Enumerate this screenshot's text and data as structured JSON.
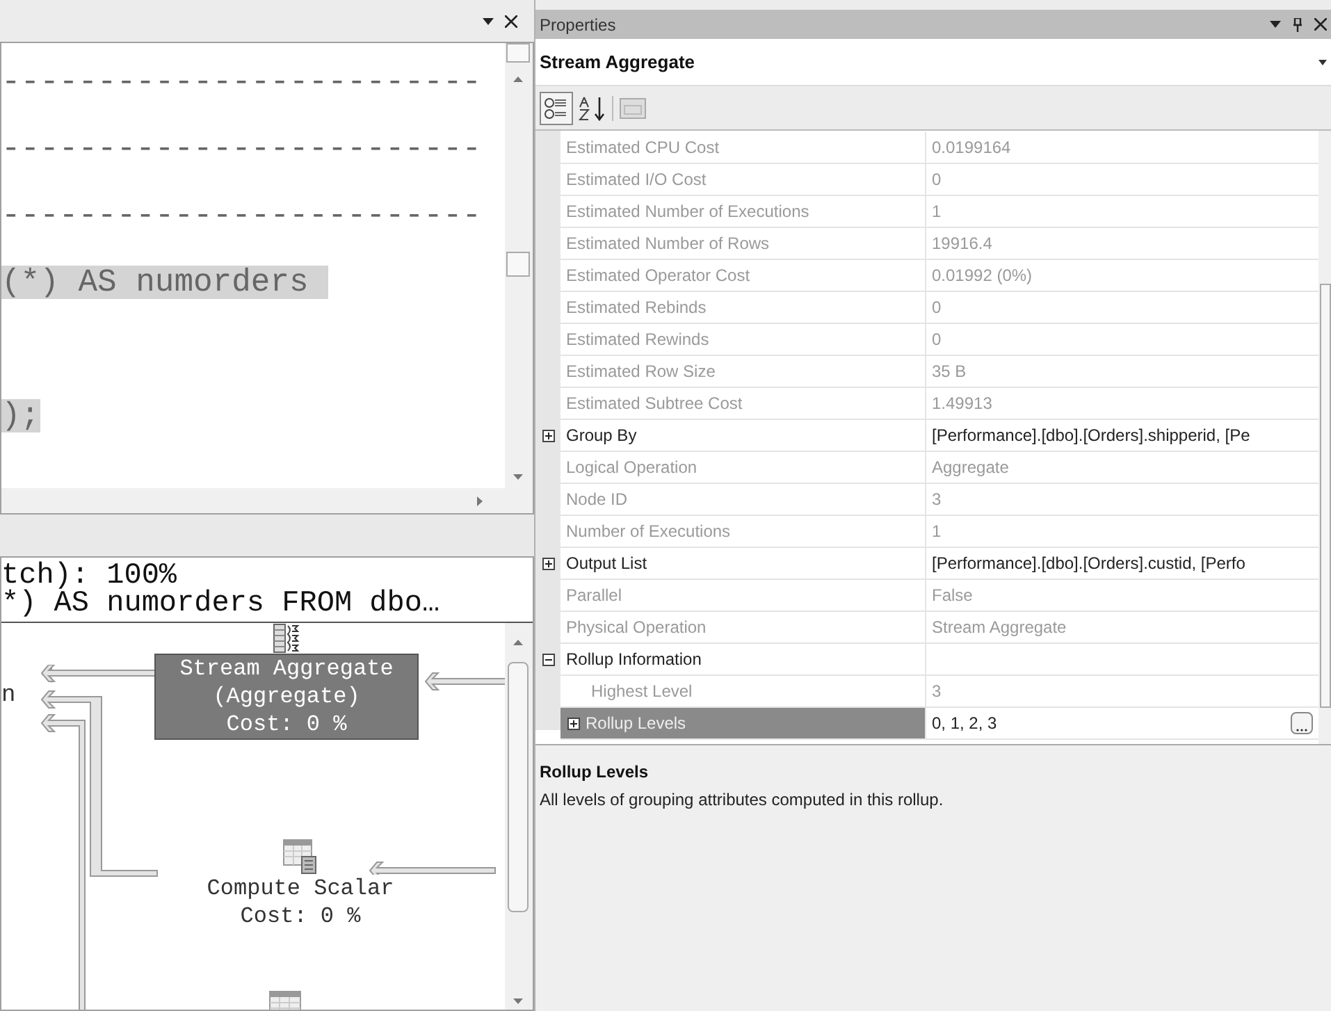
{
  "query_editor": {
    "lines": [
      {
        "text": "-------------------------",
        "highlighted": false
      },
      {
        "text": "-------------------------",
        "highlighted": false
      },
      {
        "text": "-------------------------",
        "highlighted": false
      },
      {
        "text": "(*) AS numorders ",
        "highlighted": true
      },
      {
        "highlighted": false
      },
      {
        "text": ");",
        "highlighted": true
      }
    ]
  },
  "execution_plan": {
    "header_lines": [
      "tch): 100%",
      "*) AS numorders FROM dbo…"
    ],
    "partial_label": "n",
    "nodes": [
      {
        "kind": "aggregate",
        "lines": [
          "Stream Aggregate",
          "(Aggregate)",
          "Cost: 0 %"
        ],
        "selected": true
      },
      {
        "kind": "compute",
        "lines": [
          "Compute Scalar",
          "Cost: 0 %"
        ],
        "selected": false
      },
      {
        "kind": "table",
        "selected": false
      }
    ]
  },
  "properties": {
    "title": "Properties",
    "object": "Stream Aggregate",
    "rows": [
      {
        "name": "Estimated CPU Cost",
        "value": "0.0199164",
        "readonly": true,
        "selected": false
      },
      {
        "name": "Estimated I/O Cost",
        "value": "0",
        "readonly": true,
        "selected": false
      },
      {
        "name": "Estimated Number of Executions",
        "value": "1",
        "readonly": true,
        "selected": false
      },
      {
        "name": "Estimated Number of Rows",
        "value": "19916.4",
        "readonly": true,
        "selected": false
      },
      {
        "name": "Estimated Operator Cost",
        "value": "0.01992 (0%)",
        "readonly": true,
        "selected": false
      },
      {
        "name": "Estimated Rebinds",
        "value": "0",
        "readonly": true,
        "selected": false
      },
      {
        "name": "Estimated Rewinds",
        "value": "0",
        "readonly": true,
        "selected": false
      },
      {
        "name": "Estimated Row Size",
        "value": "35 B",
        "readonly": true,
        "selected": false
      },
      {
        "name": "Estimated Subtree Cost",
        "value": "1.49913",
        "readonly": true,
        "selected": false
      },
      {
        "name": "Group By",
        "value": "[Performance].[dbo].[Orders].shipperid, [Pe",
        "readonly": false,
        "selected": false,
        "expanded": false
      },
      {
        "name": "Logical Operation",
        "value": "Aggregate",
        "readonly": true,
        "selected": false
      },
      {
        "name": "Node ID",
        "value": "3",
        "readonly": true,
        "selected": false
      },
      {
        "name": "Number of Executions",
        "value": "1",
        "readonly": true,
        "selected": false
      },
      {
        "name": "Output List",
        "value": "[Performance].[dbo].[Orders].custid, [Perfo",
        "readonly": false,
        "selected": false,
        "expanded": false
      },
      {
        "name": "Parallel",
        "value": "False",
        "readonly": true,
        "selected": false
      },
      {
        "name": "Physical Operation",
        "value": "Stream Aggregate",
        "readonly": true,
        "selected": false
      },
      {
        "name": "Rollup Information",
        "readonly": false,
        "selected": false,
        "expanded": true,
        "children": [
          {
            "name": "Highest Level",
            "value": "3",
            "readonly": true,
            "selected": false
          },
          {
            "name": "Rollup Levels",
            "value": "0, 1, 2, 3",
            "readonly": true,
            "selected": true,
            "expanded": false,
            "has_editor": true
          }
        ]
      }
    ],
    "description": {
      "title": "Rollup Levels",
      "text": "All levels of grouping attributes computed in this rollup."
    }
  }
}
